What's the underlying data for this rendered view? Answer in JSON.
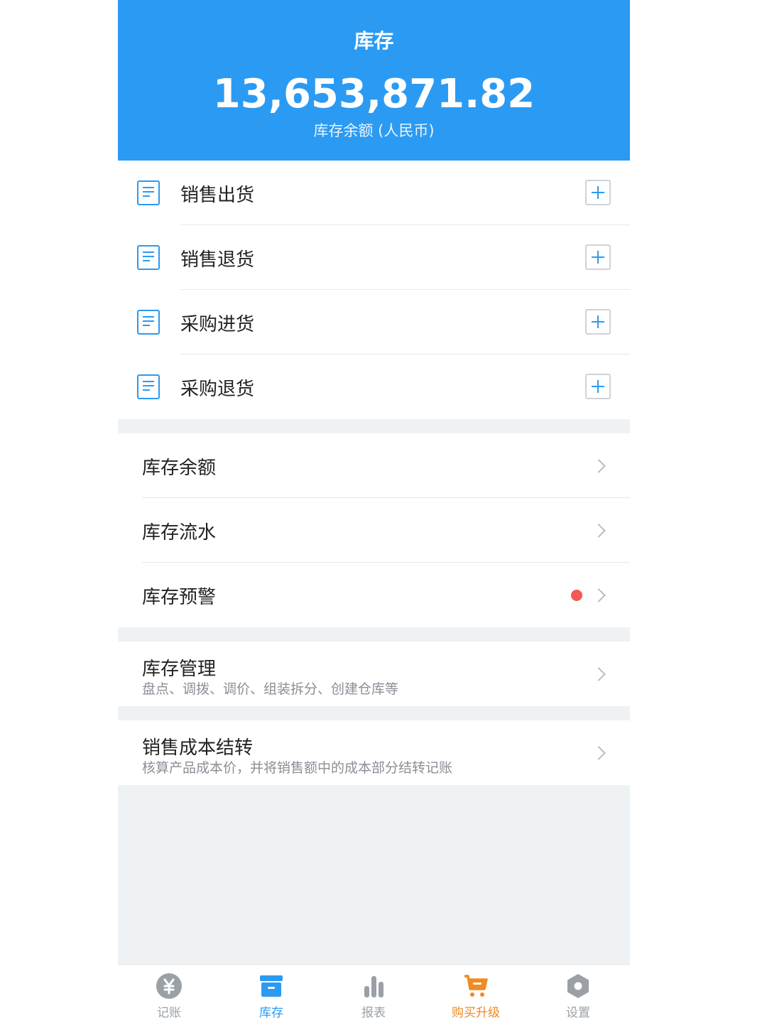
{
  "header": {
    "title": "库存",
    "amount": "13,653,871.82",
    "subtitle": "库存余额 (人民币)"
  },
  "doc_items": [
    {
      "label": "销售出货"
    },
    {
      "label": "销售退货"
    },
    {
      "label": "采购进货"
    },
    {
      "label": "采购退货"
    }
  ],
  "nav_items": [
    {
      "label": "库存余额"
    },
    {
      "label": "库存流水"
    },
    {
      "label": "库存预警",
      "has_alert": true
    }
  ],
  "manage": {
    "label": "库存管理",
    "desc": "盘点、调拨、调价、组装拆分、创建仓库等"
  },
  "cost": {
    "label": "销售成本结转",
    "desc": "核算产品成本价，并将销售额中的成本部分结转记账"
  },
  "tabs": [
    {
      "label": "记账",
      "icon": "yen-icon"
    },
    {
      "label": "库存",
      "icon": "box-icon",
      "active": true
    },
    {
      "label": "报表",
      "icon": "bar-chart-icon"
    },
    {
      "label": "购买升级",
      "icon": "cart-icon",
      "promo": true
    },
    {
      "label": "设置",
      "icon": "hexagon-settings-icon"
    }
  ],
  "colors": {
    "primary": "#2b9af3",
    "alert": "#f25a55",
    "promo": "#f08a24",
    "background": "#eff2f5"
  }
}
